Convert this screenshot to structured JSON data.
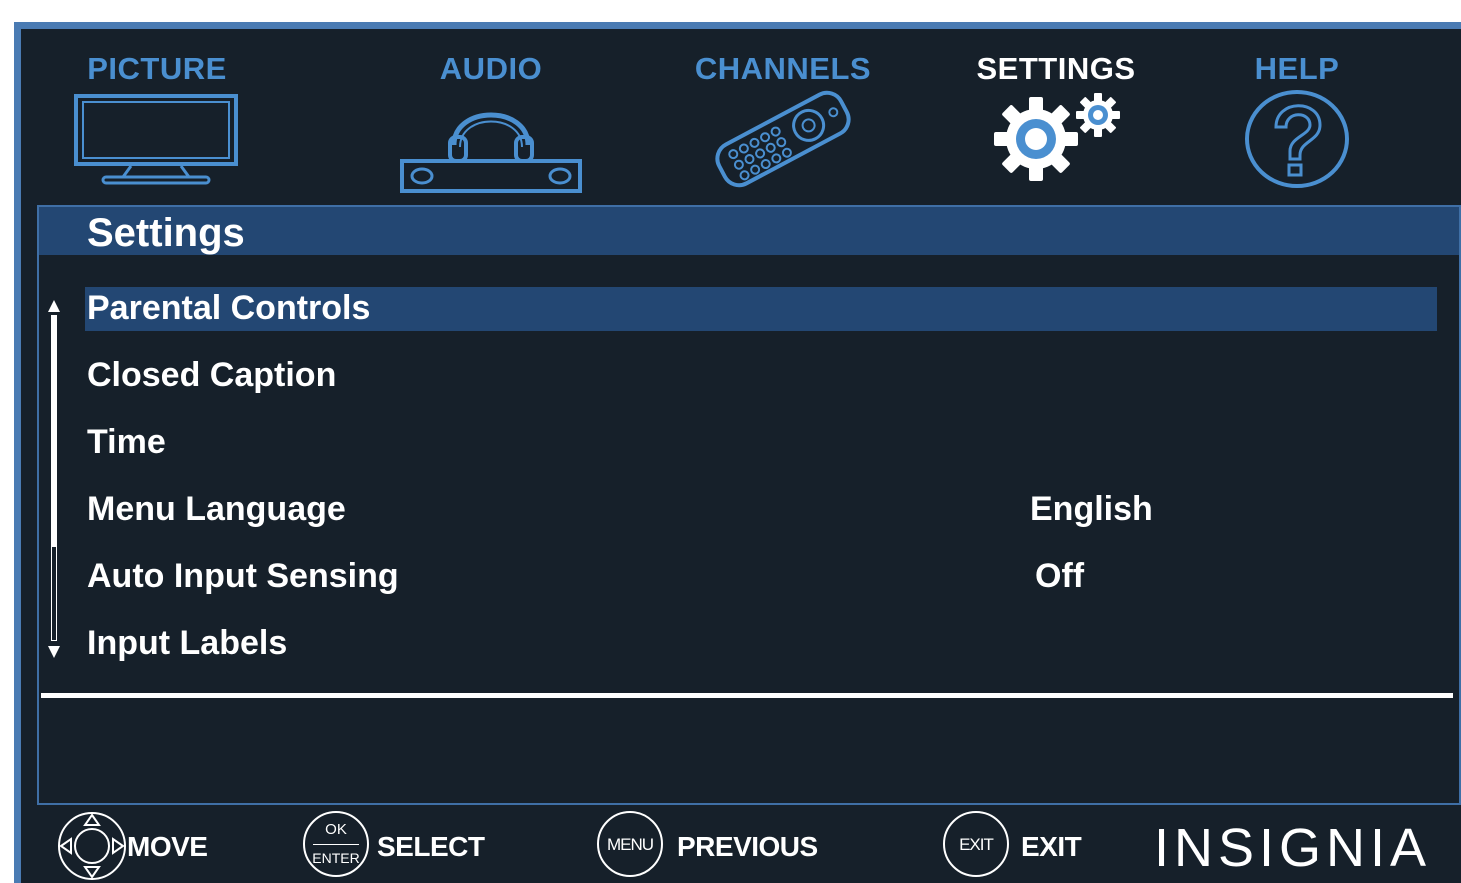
{
  "tabs": [
    {
      "label": "PICTURE",
      "icon": "tv-icon",
      "active": false
    },
    {
      "label": "AUDIO",
      "icon": "headphones-icon",
      "active": false
    },
    {
      "label": "CHANNELS",
      "icon": "remote-icon",
      "active": false
    },
    {
      "label": "SETTINGS",
      "icon": "gear-icon",
      "active": true
    },
    {
      "label": "HELP",
      "icon": "help-icon",
      "active": false
    }
  ],
  "panel": {
    "title": "Settings",
    "items": [
      {
        "label": "Parental Controls",
        "value": "",
        "selected": true
      },
      {
        "label": "Closed Caption",
        "value": ""
      },
      {
        "label": "Time",
        "value": ""
      },
      {
        "label": "Menu Language",
        "value": "English"
      },
      {
        "label": "Auto Input Sensing",
        "value": "Off"
      },
      {
        "label": "Input Labels",
        "value": ""
      }
    ]
  },
  "footer": {
    "move": {
      "label": "MOVE",
      "icon": "dpad-icon"
    },
    "select": {
      "label": "SELECT",
      "btn_top": "OK",
      "btn_bottom": "ENTER"
    },
    "previous": {
      "label": "PREVIOUS",
      "btn": "MENU"
    },
    "exit": {
      "label": "EXIT",
      "btn": "EXIT"
    },
    "brand": "INSIGNIA"
  },
  "colors": {
    "background": "#16202a",
    "accent": "#4a8fd0",
    "frame": "#4a7bb3",
    "selection": "#234773",
    "text": "#ffffff"
  }
}
